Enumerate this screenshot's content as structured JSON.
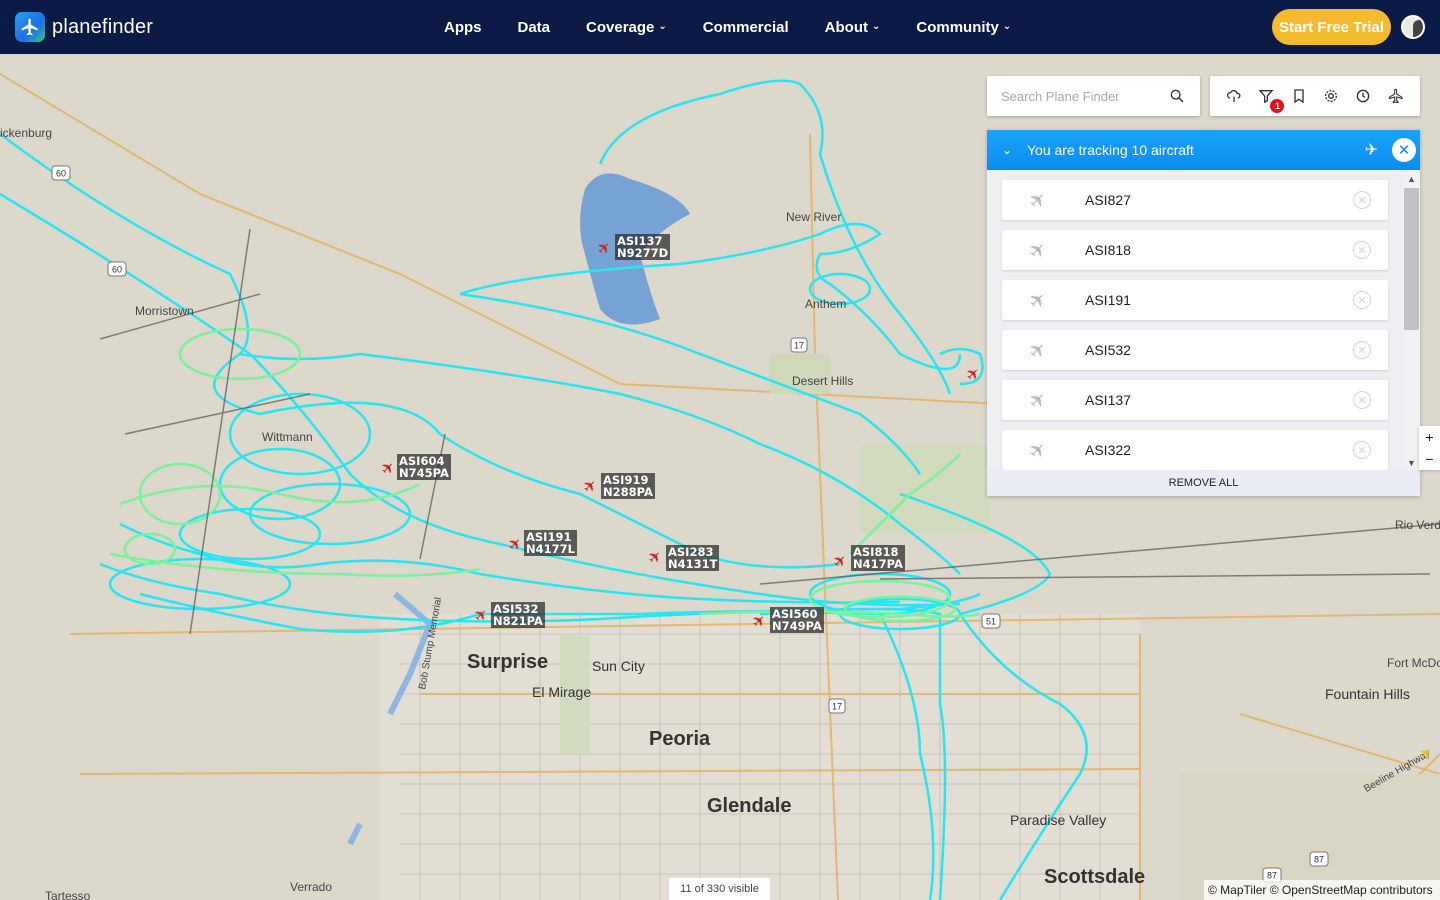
{
  "brand": {
    "name": "planefinder"
  },
  "nav": {
    "items": [
      {
        "label": "Apps",
        "has_menu": false
      },
      {
        "label": "Data",
        "has_menu": false
      },
      {
        "label": "Coverage",
        "has_menu": true
      },
      {
        "label": "Commercial",
        "has_menu": false
      },
      {
        "label": "About",
        "has_menu": true
      },
      {
        "label": "Community",
        "has_menu": true
      }
    ],
    "cta_label": "Start Free Trial"
  },
  "search": {
    "placeholder": "Search Plane Finder"
  },
  "toolbar": {
    "icons": [
      "weather-icon",
      "filter-icon",
      "bookmark-icon",
      "settings-icon",
      "history-icon",
      "airport-icon"
    ],
    "filter_badge": "1"
  },
  "tracking": {
    "title": "You are tracking 10 aircraft",
    "rows": [
      "ASI827",
      "ASI818",
      "ASI191",
      "ASI532",
      "ASI137",
      "ASI322"
    ],
    "remove_all": "REMOVE ALL"
  },
  "zoom": {
    "plus": "+",
    "minus": "−"
  },
  "map": {
    "places": [
      {
        "name": "ickenburg",
        "size": "small"
      },
      {
        "name": "Morristown",
        "size": "small"
      },
      {
        "name": "New River",
        "size": "small"
      },
      {
        "name": "Anthem",
        "size": "small"
      },
      {
        "name": "Desert Hills",
        "size": "small"
      },
      {
        "name": "Surprise",
        "size": "big"
      },
      {
        "name": "Sun City",
        "size": "med"
      },
      {
        "name": "El Mirage",
        "size": "med"
      },
      {
        "name": "Peoria",
        "size": "big"
      },
      {
        "name": "Glendale",
        "size": "big"
      },
      {
        "name": "Paradise Valley",
        "size": "med"
      },
      {
        "name": "Scottsdale",
        "size": "big"
      },
      {
        "name": "Fountain Hills",
        "size": "med"
      },
      {
        "name": "Fort McDo",
        "size": "small"
      },
      {
        "name": "Rio Verde",
        "size": "small"
      },
      {
        "name": "Verrado",
        "size": "small"
      },
      {
        "name": "Tartesso",
        "size": "small"
      },
      {
        "name": "Bob Stump Memorial",
        "size": "small"
      },
      {
        "name": "Beeline Highway",
        "size": "small"
      },
      {
        "name": "Wittmann",
        "size": "small"
      }
    ],
    "aircraft": [
      {
        "callsign": "ASI137",
        "reg": "N9277D"
      },
      {
        "callsign": "ASI604",
        "reg": "N745PA"
      },
      {
        "callsign": "ASI919",
        "reg": "N288PA"
      },
      {
        "callsign": "ASI191",
        "reg": "N4177L"
      },
      {
        "callsign": "ASI283",
        "reg": "N4131T"
      },
      {
        "callsign": "ASI818",
        "reg": "N417PA"
      },
      {
        "callsign": "ASI532",
        "reg": "N821PA"
      },
      {
        "callsign": "ASI560",
        "reg": "N749PA"
      }
    ],
    "route_shields": [
      "60",
      "60",
      "17",
      "17",
      "51",
      "87",
      "87"
    ],
    "visible_count": "11 of 330 visible",
    "attribution": "© MapTiler © OpenStreetMap contributors"
  },
  "colors": {
    "nav_bg": "#0b1b45",
    "cta": "#f5bb2f",
    "panel_head": "#0b8cef",
    "track_primary": "#27e6f2",
    "track_secondary": "#7cf29c",
    "aircraft": "#d11f1f"
  }
}
